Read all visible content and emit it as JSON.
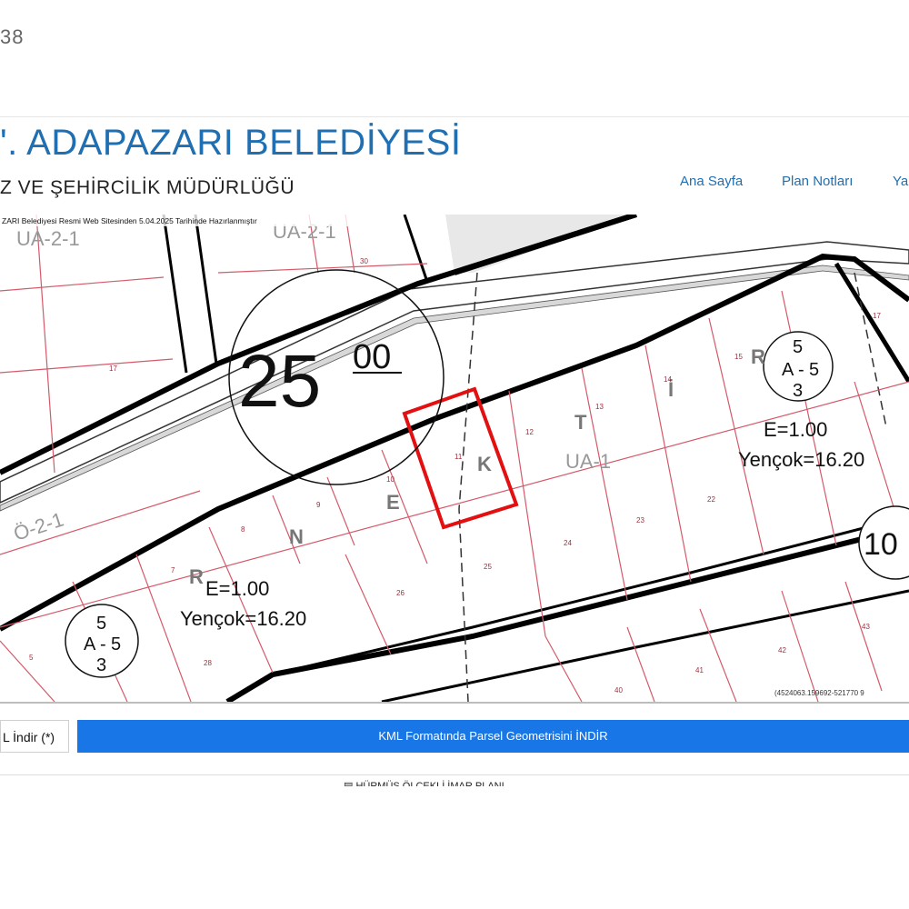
{
  "page_number": "38",
  "header": {
    "title": "'. ADAPAZARI BELEDİYESİ",
    "subtitle": "Z VE ŞEHİRCİLİK MÜDÜRLÜĞÜ",
    "nav": [
      "Ana Sayfa",
      "Plan Notları",
      "Ya"
    ]
  },
  "map": {
    "notice": "ZARI Belediyesi Resmi Web Sitesinden 5.04.2025 Tarihinde Hazırlanmıştır",
    "road_width_main": "25",
    "road_width_decimal": "00",
    "road_width_right": "10",
    "zone_labels": [
      "UA-2-1",
      "UA-2-1",
      "Ö-2-1",
      "UA-1"
    ],
    "street_letters": [
      "N",
      "E",
      "K",
      "T",
      "İ",
      "R",
      "R"
    ],
    "density_left": {
      "e": "E=1.00",
      "height": "Yençok=16.20"
    },
    "density_right": {
      "e": "E=1.00",
      "height": "Yençok=16.20"
    },
    "zone_symbol": {
      "top": "5",
      "mid": "A",
      "sep": "-",
      "right": "5",
      "bottom": "3"
    },
    "parcels": [
      "17",
      "9",
      "8",
      "7",
      "5",
      "10",
      "11",
      "12",
      "13",
      "14",
      "15",
      "17",
      "22",
      "23",
      "24",
      "25",
      "26",
      "28",
      "40",
      "41",
      "42",
      "43",
      "17",
      "30"
    ],
    "coords": "(4524063.159692-521770 9"
  },
  "buttons": {
    "left": "L İndir (*)",
    "kml": "KML Formatında Parsel Geometrisini İNDİR"
  },
  "footer_cut": "▤ HÜRMÜŞ ÖLÇEKLİ İMAR PLANI",
  "colors": {
    "brand_blue": "#1f6fb2",
    "kml_button": "#1976e6",
    "parcel_line": "#d45a6a",
    "highlight": "#e21010"
  }
}
